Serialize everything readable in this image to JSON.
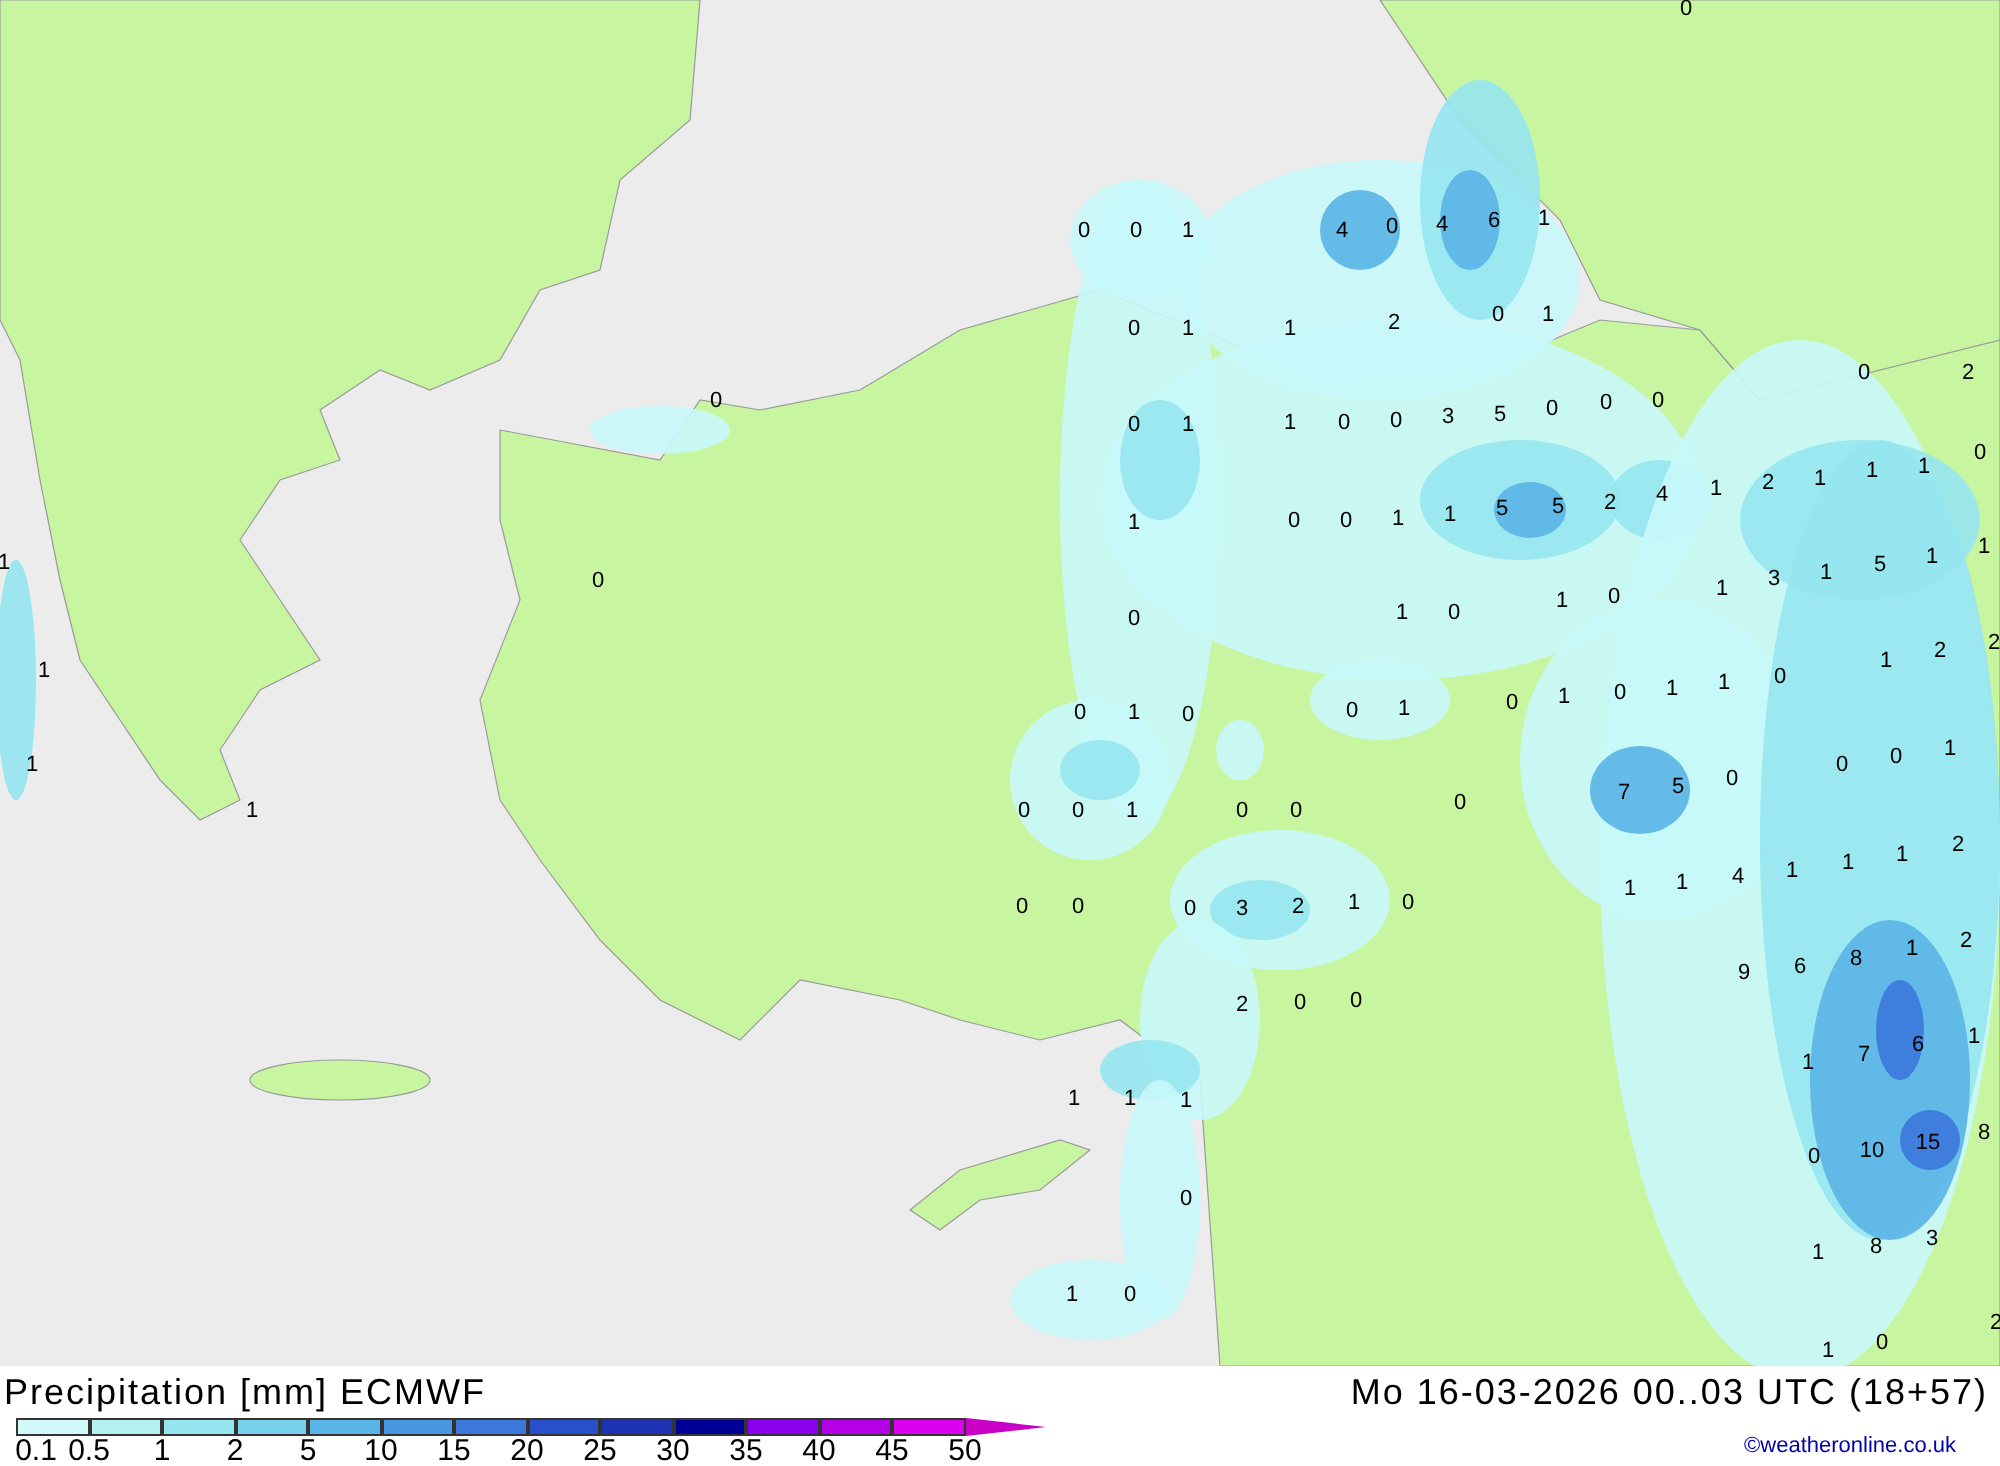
{
  "map": {
    "labels": [
      "0",
      "0",
      "1",
      "4",
      "0",
      "4",
      "6",
      "1",
      "0",
      "1",
      "1",
      "2",
      "0",
      "1",
      "0",
      "0",
      "2",
      "0",
      "0",
      "1",
      "1",
      "0",
      "0",
      "3",
      "5",
      "0",
      "0",
      "0",
      "1",
      "0",
      "1",
      "2",
      "1",
      "1",
      "4",
      "2",
      "1",
      "0",
      "0",
      "1",
      "1",
      "5",
      "5",
      "5",
      "1",
      "1",
      "0",
      "1",
      "3",
      "1",
      "1",
      "0",
      "1",
      "0",
      "0",
      "1",
      "2",
      "2",
      "1",
      "0",
      "1",
      "0",
      "1",
      "1",
      "0",
      "0",
      "1",
      "0",
      "0",
      "1",
      "0",
      "0",
      "1",
      "1",
      "1",
      "7",
      "5",
      "0",
      "1",
      "0",
      "0",
      "1",
      "0",
      "0",
      "0",
      "1",
      "1",
      "2",
      "1",
      "1",
      "4",
      "1",
      "0",
      "0",
      "0",
      "3",
      "2",
      "1",
      "0",
      "9",
      "6",
      "8",
      "1",
      "2",
      "2",
      "0",
      "0",
      "1",
      "7",
      "6",
      "1",
      "1",
      "1",
      "1",
      "0",
      "10",
      "15",
      "8",
      "0",
      "1",
      "8",
      "3",
      "1",
      "0",
      "2",
      "1",
      "0"
    ]
  },
  "footer": {
    "title": "Precipitation [mm] ECMWF",
    "valid_time": "Mo 16-03-2026 00..03 UTC (18+57)",
    "credit": "©weatheronline.co.uk"
  },
  "legend": {
    "bins": [
      {
        "color": "#d2fafa"
      },
      {
        "color": "#b4f0f0"
      },
      {
        "color": "#96e6f0"
      },
      {
        "color": "#78d2eb"
      },
      {
        "color": "#5ab4e6"
      },
      {
        "color": "#4696e1"
      },
      {
        "color": "#3c78dc"
      },
      {
        "color": "#2850c8"
      },
      {
        "color": "#1e32b4"
      },
      {
        "color": "#000096"
      },
      {
        "color": "#8c00f0"
      },
      {
        "color": "#b400e6"
      },
      {
        "color": "#dc00f0"
      }
    ],
    "over": {
      "color": "#c800c8"
    },
    "ticks": [
      "0.1",
      "0.5",
      "1",
      "2",
      "5",
      "10",
      "15",
      "20",
      "25",
      "30",
      "35",
      "40",
      "45",
      "50"
    ]
  }
}
